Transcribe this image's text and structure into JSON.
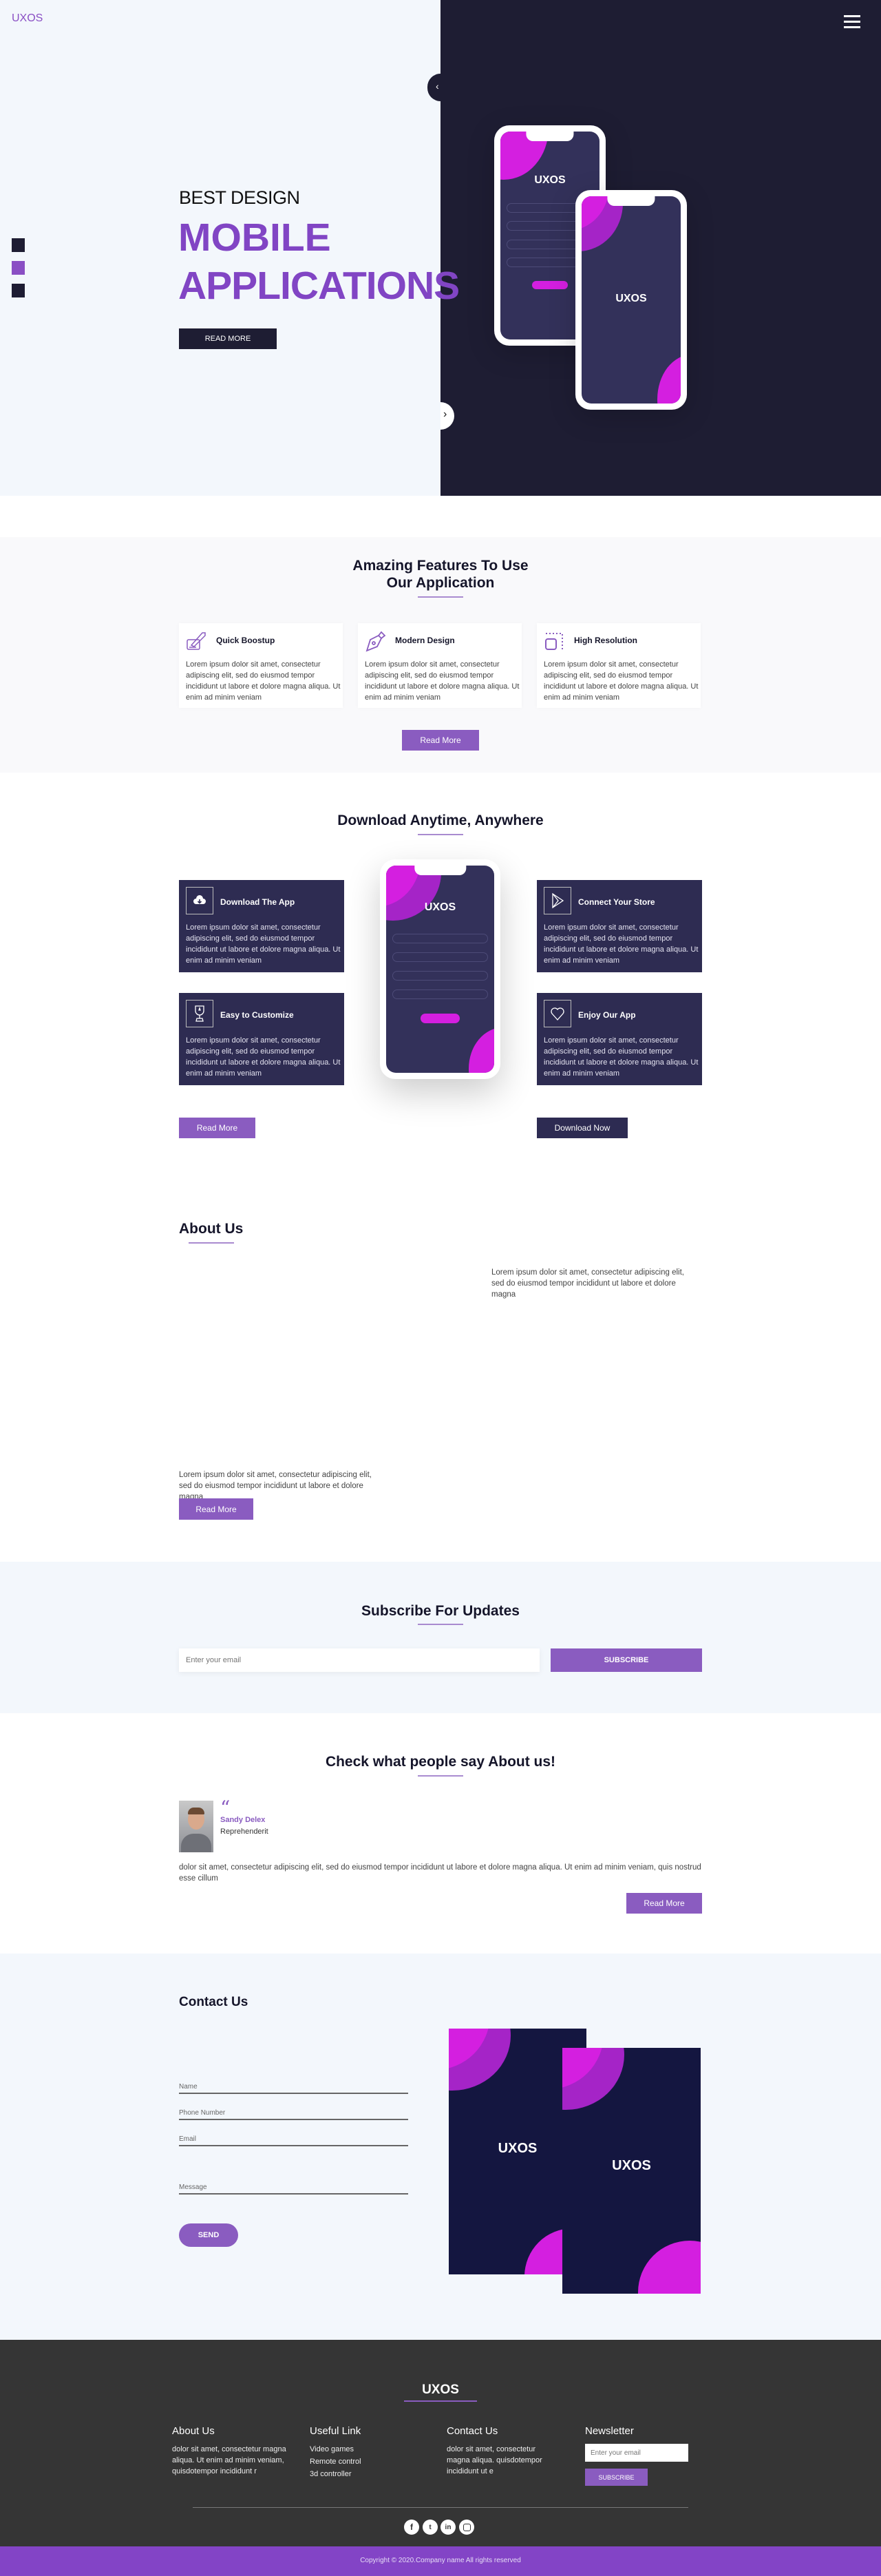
{
  "colors": {
    "accent": "#8a5cc0",
    "dark": "#1e1d33",
    "card": "#2e2c52",
    "magenta": "#d41fe0",
    "footer": "#353535",
    "copyright_bar": "#8344c6"
  },
  "hero": {
    "logo": "UXOS",
    "menu_icon": "hamburger-icon",
    "subtitle": "BEST DESIGN",
    "title_line1": "MOBILE",
    "title_line2": "APPLICATIONS",
    "cta": "READ MORE",
    "phone_logo": "UXOS",
    "phone2_logo": "UXOS"
  },
  "features": {
    "title_line1": "Amazing Features To Use",
    "title_line2": "Our Application",
    "items": [
      {
        "icon": "rocket-icon",
        "title": "Quick Boostup",
        "text": "Lorem ipsum dolor sit amet, consectetur adipiscing elit, sed do eiusmod tempor incididunt ut labore et dolore magna aliqua. Ut enim ad minim veniam"
      },
      {
        "icon": "pen-nib-icon",
        "title": "Modern Design",
        "text": "Lorem ipsum dolor sit amet, consectetur adipiscing elit, sed do eiusmod tempor incididunt ut labore et dolore magna aliqua. Ut enim ad minim veniam"
      },
      {
        "icon": "resolution-icon",
        "title": "High Resolution",
        "text": "Lorem ipsum dolor sit amet, consectetur adipiscing elit, sed do eiusmod tempor incididunt ut labore et dolore magna aliqua. Ut enim ad minim veniam"
      }
    ],
    "button": "Read More"
  },
  "download": {
    "title": "Download Anytime, Anywhere",
    "phone_logo": "UXOS",
    "cards": [
      {
        "icon": "cloud-download-icon",
        "title": "Download The App",
        "text": "Lorem ipsum dolor sit amet, consectetur adipiscing elit, sed do eiusmod tempor incididunt ut labore et dolore magna aliqua. Ut enim ad minim veniam"
      },
      {
        "icon": "trophy-icon",
        "title": "Easy to Customize",
        "text": "Lorem ipsum dolor sit amet, consectetur adipiscing elit, sed do eiusmod tempor incididunt ut labore et dolore magna aliqua. Ut enim ad minim veniam"
      },
      {
        "icon": "play-icon",
        "title": "Connect Your Store",
        "text": "Lorem ipsum dolor sit amet, consectetur adipiscing elit, sed do eiusmod tempor incididunt ut labore et dolore magna aliqua. Ut enim ad minim veniam"
      },
      {
        "icon": "heart-icon",
        "title": "Enjoy Our App",
        "text": "Lorem ipsum dolor sit amet, consectetur adipiscing elit, sed do eiusmod tempor incididunt ut labore et dolore magna aliqua. Ut enim ad minim veniam"
      }
    ],
    "read_more": "Read More",
    "download_now": "Download Now"
  },
  "about": {
    "title": "About Us",
    "text_right": "Lorem ipsum dolor sit amet, consectetur adipiscing elit, sed do eiusmod tempor incididunt ut labore et dolore magna",
    "text_left": "Lorem ipsum dolor sit amet, consectetur adipiscing elit, sed do eiusmod tempor incididunt ut labore et dolore magna",
    "button": "Read More"
  },
  "subscribe": {
    "title": "Subscribe For Updates",
    "placeholder": "Enter your email",
    "button": "SUBSCRIBE"
  },
  "testimonial": {
    "title": "Check what people say About us!",
    "name": "Sandy Delex",
    "role": "Reprehenderit",
    "quote": "dolor sit amet, consectetur adipiscing elit, sed do eiusmod tempor incididunt ut labore et dolore magna aliqua. Ut enim ad minim veniam, quis nostrud esse cillum",
    "button": "Read More"
  },
  "contact": {
    "title": "Contact Us",
    "fields": [
      "Name",
      "Phone Number",
      "Email",
      "Message"
    ],
    "button": "SEND",
    "poster1_logo": "UXOS",
    "poster2_logo": "UXOS"
  },
  "footer": {
    "logo": "UXOS",
    "about": {
      "title": "About Us",
      "text": "dolor sit amet, consectetur magna aliqua. Ut enim ad minim veniam, quisdotempor incididunt r"
    },
    "links": {
      "title": "Useful Link",
      "items": [
        "Video games",
        "Remote control",
        "3d controller"
      ]
    },
    "contact": {
      "title": "Contact Us",
      "text": "dolor sit amet, consectetur magna aliqua. quisdotempor incididunt ut e"
    },
    "newsletter": {
      "title": "Newsletter",
      "placeholder": "Enter your email",
      "button": "SUBSCRIBE"
    },
    "social": [
      "facebook-icon",
      "twitter-icon",
      "linkedin-icon",
      "instagram-icon"
    ],
    "copyright": "Copyright © 2020.Company name All rights reserved"
  }
}
